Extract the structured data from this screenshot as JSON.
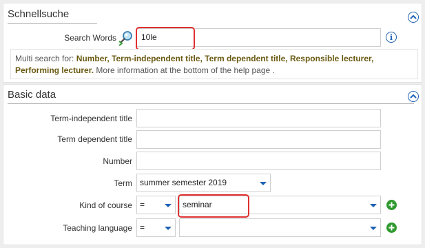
{
  "quick_search": {
    "title": "Schnellsuche",
    "search_label": "Search Words",
    "search_value": "10le",
    "hint": {
      "prefix": "Multi search for: ",
      "fields": "Number, Term-independent title, Term dependent title, Responsible lecturer, Performing lecturer.",
      "suffix": " More information at the bottom of the  help page ."
    },
    "icons": {
      "search": "search-magnifier-icon",
      "info": "info-icon",
      "collapse": "collapse-up-icon"
    }
  },
  "basic_data": {
    "title": "Basic data",
    "fields": {
      "term_independent_title": {
        "label": "Term-independent title",
        "value": ""
      },
      "term_dependent_title": {
        "label": "Term dependent title",
        "value": ""
      },
      "number": {
        "label": "Number",
        "value": ""
      },
      "term": {
        "label": "Term",
        "value": "summer semester 2019"
      },
      "kind_of_course": {
        "label": "Kind of course",
        "operator": "=",
        "value": "seminar"
      },
      "teaching_language": {
        "label": "Teaching language",
        "operator": "=",
        "value": ""
      }
    },
    "icons": {
      "collapse": "collapse-up-icon",
      "add": "add-circle-icon",
      "dropdown": "chevron-down-icon"
    }
  },
  "colors": {
    "accent_blue": "#1e62b4",
    "highlight_red": "#e03030",
    "hint_bold": "#6a5a12",
    "add_green": "#2f9a2f"
  }
}
